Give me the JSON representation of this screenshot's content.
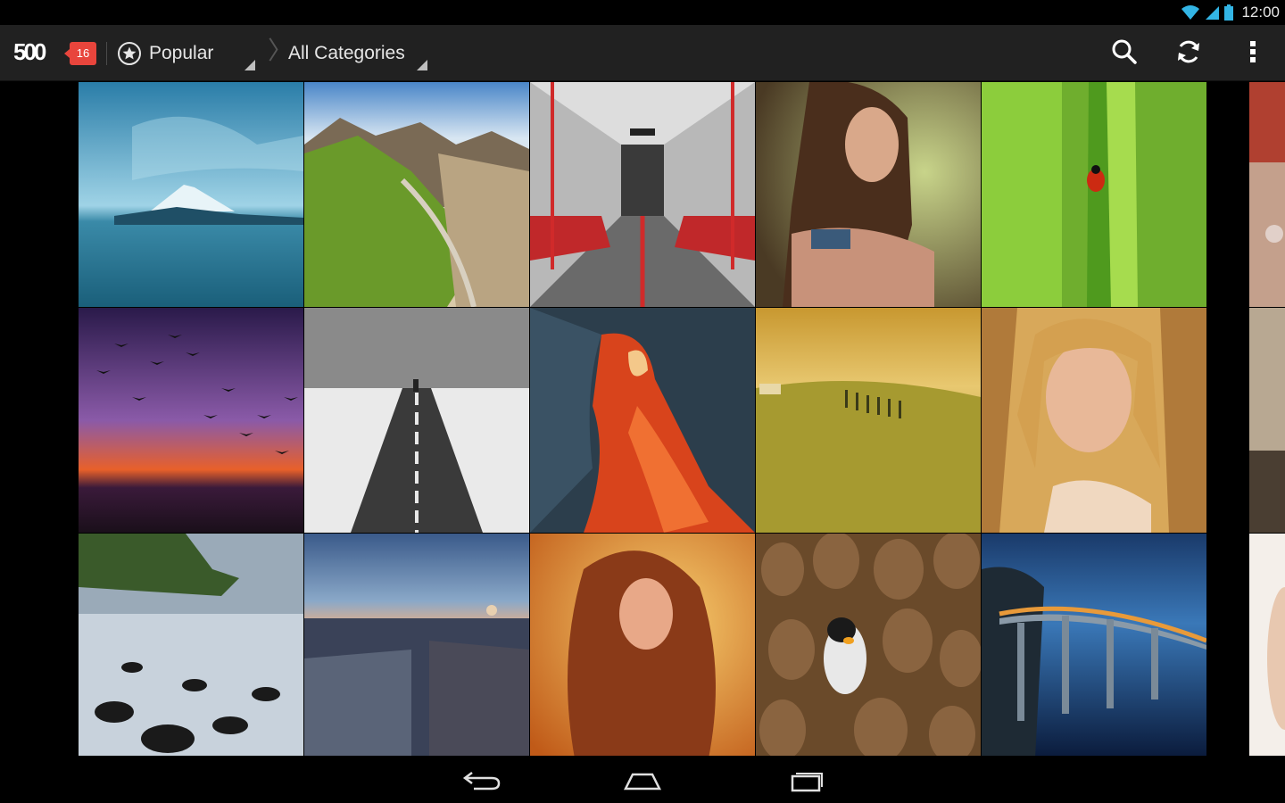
{
  "status_bar": {
    "time": "12:00",
    "icons": [
      "wifi-icon",
      "signal-icon",
      "battery-icon"
    ]
  },
  "app": {
    "logo_text": "500",
    "notification_count": "16",
    "feed_selector": {
      "label": "Popular",
      "icon": "star-circle-icon"
    },
    "category_selector": {
      "label": "All Categories"
    },
    "actions": [
      {
        "name": "search",
        "icon": "search-icon"
      },
      {
        "name": "refresh",
        "icon": "refresh-icon"
      },
      {
        "name": "overflow-menu",
        "icon": "more-vert-icon"
      }
    ],
    "accent_color": "#e8453c"
  },
  "photos": {
    "rows": [
      [
        "blue-lake-mountain",
        "green-mountain-valley",
        "subway-car-interior",
        "woman-portrait-bracelets",
        "ladybug-on-grass",
        "partial-bokeh"
      ],
      [
        "birds-purple-sunset",
        "snowy-road-umbrella",
        "red-sandstone-cave",
        "golden-hills-cypress",
        "blonde-woman-golden-grass",
        "partial-room"
      ],
      [
        "rocky-beach-mist",
        "paris-rooftops-dusk",
        "woman-red-hair-sunset",
        "king-penguin-colony",
        "coastal-bridge-night",
        "partial-portrait"
      ]
    ]
  },
  "navigation_bar": {
    "buttons": [
      {
        "name": "back",
        "icon": "back-icon"
      },
      {
        "name": "home",
        "icon": "home-icon"
      },
      {
        "name": "recents",
        "icon": "recents-icon"
      }
    ]
  }
}
